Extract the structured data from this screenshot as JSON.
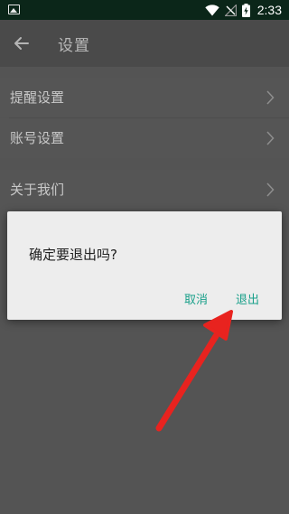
{
  "status_bar": {
    "time": "2:33",
    "icons": [
      "gallery-notification-icon",
      "wifi-icon",
      "no-signal-icon",
      "battery-charging-icon"
    ]
  },
  "app_bar": {
    "back_icon": "arrow-left-icon",
    "title": "设置"
  },
  "settings": {
    "items": [
      {
        "label": "提醒设置",
        "icon": "chevron-right-icon"
      },
      {
        "label": "账号设置",
        "icon": "chevron-right-icon"
      },
      {
        "label": "关于我们",
        "icon": "chevron-right-icon"
      }
    ]
  },
  "dialog": {
    "message": "确定要退出吗?",
    "cancel_label": "取消",
    "exit_label": "退出"
  },
  "colors": {
    "status_bar": "#0b2619",
    "dialog_button": "#1aa08a",
    "annotation_arrow": "#e8231f"
  }
}
